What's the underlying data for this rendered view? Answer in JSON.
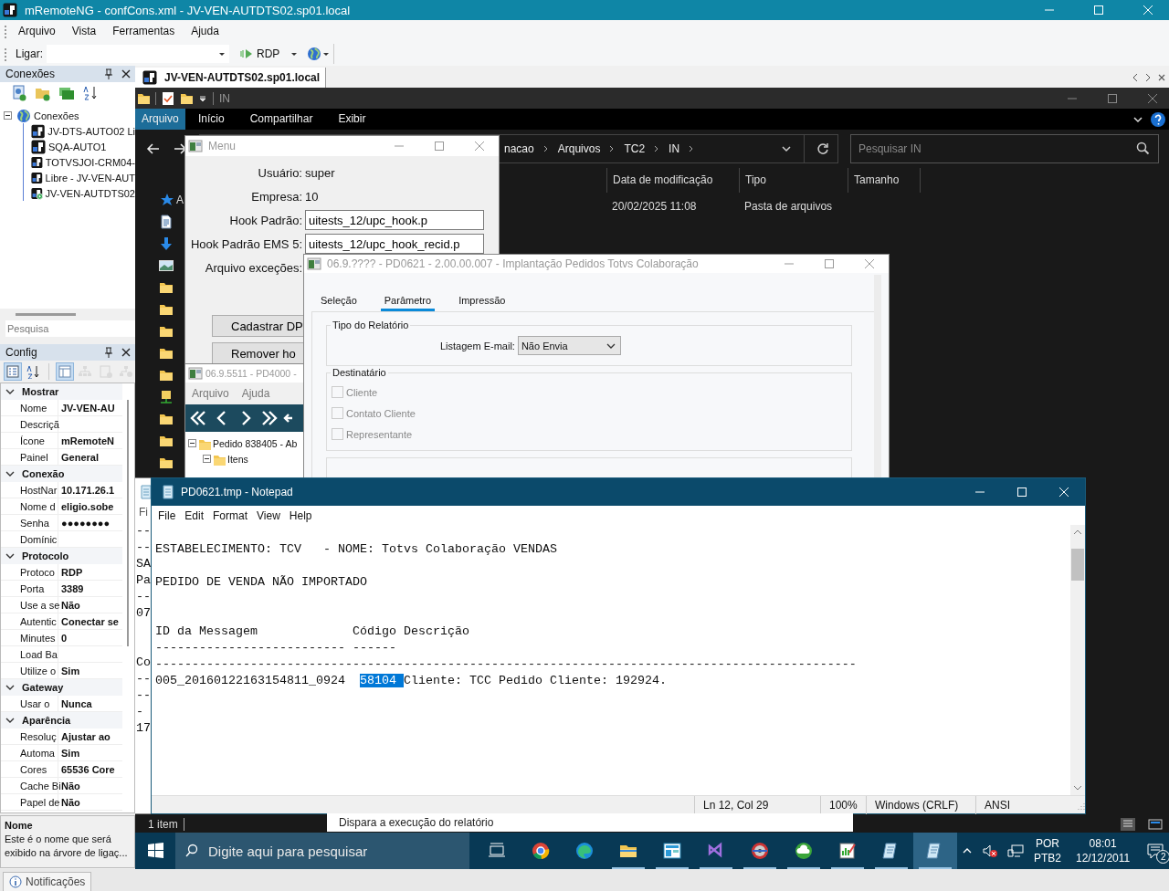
{
  "app": {
    "title": "mRemoteNG - confCons.xml - JV-VEN-AUTDTS02.sp01.local",
    "menu": [
      "Arquivo",
      "Vista",
      "Ferramentas",
      "Ajuda"
    ],
    "connect_label": "Ligar:",
    "protocol": "RDP"
  },
  "connections": {
    "title": "Conexões",
    "root": {
      "label": "Conexões",
      "expanded": true,
      "children": [
        {
          "label": "JV-DTS-AUTO02 Li",
          "connected": false
        },
        {
          "label": "SQA-AUTO1",
          "connected": false
        },
        {
          "label": "TOTVSJOI-CRM04-",
          "connected": false
        },
        {
          "label": "Libre - JV-VEN-AUT",
          "connected": false
        },
        {
          "label": "JV-VEN-AUTDTS02",
          "connected": true
        }
      ]
    },
    "search_placeholder": "Pesquisa"
  },
  "config": {
    "title": "Config",
    "view_buttons": [
      {
        "kind": "categorized",
        "selected": true,
        "disabled": false
      },
      {
        "kind": "alphabetical",
        "selected": false,
        "disabled": false
      },
      {
        "kind": "properties",
        "selected": true,
        "disabled": false
      },
      {
        "kind": "hierarchy",
        "selected": false,
        "disabled": true
      },
      {
        "kind": "page_add",
        "selected": false,
        "disabled": true
      },
      {
        "kind": "tree_add",
        "selected": false,
        "disabled": true
      }
    ],
    "groups": [
      {
        "name": "Mostrar",
        "expanded": true,
        "properties": [
          {
            "name": "Nome",
            "value": "JV-VEN-AU"
          },
          {
            "name": "Descriçã"
          },
          {
            "name": "Ícone",
            "value": "mRemoteN"
          },
          {
            "name": "Painel",
            "value": "General"
          }
        ]
      },
      {
        "name": "Conexão",
        "expanded": true,
        "properties": [
          {
            "name": "HostNar",
            "value": "10.171.26.1"
          },
          {
            "name": "Nome d",
            "value": "eligio.sobe"
          },
          {
            "name": "Senha",
            "value": "●●●●●●●●"
          },
          {
            "name": "Domínic"
          }
        ]
      },
      {
        "name": "Protocolo",
        "expanded": true,
        "properties": [
          {
            "name": "Protoco",
            "value": "RDP"
          },
          {
            "name": "Porta",
            "value": "3389"
          },
          {
            "name": "Use a se",
            "value": "Não"
          },
          {
            "name": "Autentic",
            "value": "Conectar se"
          },
          {
            "name": "Minutes",
            "value": "0"
          },
          {
            "name": "Load Ba"
          },
          {
            "name": "Utilize o",
            "value": "Sim"
          }
        ]
      },
      {
        "name": "Gateway",
        "expanded": true,
        "properties": [
          {
            "name": "Usar o",
            "value": "Nunca"
          }
        ]
      },
      {
        "name": "Aparência",
        "expanded": true,
        "properties": [
          {
            "name": "Resoluç",
            "value": "Ajustar ao"
          },
          {
            "name": "Automa",
            "value": "Sim"
          },
          {
            "name": "Cores",
            "value": "65536 Core"
          },
          {
            "name": "Cache Bi",
            "value": "Não"
          },
          {
            "name": "Papel de",
            "value": "Não"
          }
        ]
      }
    ],
    "help": {
      "title": "Nome",
      "text": "Este é o nome que será exibido na árvore de ligaç..."
    }
  },
  "document_tab": {
    "title": "JV-VEN-AUTDTS02.sp01.local",
    "selected": true
  },
  "explorer": {
    "quick_title": "IN",
    "ribbon_tabs": [
      {
        "label": "Arquivo",
        "selected": true
      },
      {
        "label": "Início",
        "selected": false
      },
      {
        "label": "Compartilhar",
        "selected": false
      },
      {
        "label": "Exibir",
        "selected": false
      }
    ],
    "breadcrumb": [
      "nacao",
      "Arquivos",
      "TC2",
      "IN"
    ],
    "search_placeholder": "Pesquisar IN",
    "nav_label": "A",
    "columns": [
      "Data de modificação",
      "Tipo",
      "Tamanho"
    ],
    "rows": [
      {
        "modified": "20/02/2025 11:08",
        "type": "Pasta de arquivos"
      }
    ],
    "status": "1 item"
  },
  "menu_window": {
    "title": "Menu",
    "info": [
      {
        "label": "Usuário:",
        "value": "super"
      },
      {
        "label": "Empresa:",
        "value": "10"
      }
    ],
    "fields": [
      {
        "label": "Hook Padrão:",
        "value": "uitests_12/upc_hook.p"
      },
      {
        "label": "Hook Padrão EMS 5:",
        "value": "uitests_12/upc_hook_recid.p"
      },
      {
        "label": "Arquivo exceções:"
      }
    ],
    "buttons": [
      "Cadastrar DP",
      "Remover ho"
    ]
  },
  "pd4000_window": {
    "title": "06.9.5511 - PD4000 -",
    "menu": [
      "Arquivo",
      "Ajuda"
    ],
    "tree": [
      {
        "label": "Pedido 838405 - Ab",
        "expanded": true,
        "children": [
          {
            "label": "Itens",
            "expanded": true
          }
        ]
      }
    ]
  },
  "pd0621_window": {
    "title": "06.9.???? - PD0621 - 2.00.00.007 - Implantação Pedidos Totvs Colaboração",
    "tabs": [
      {
        "label": "Seleção",
        "selected": false
      },
      {
        "label": "Parâmetro",
        "selected": true
      },
      {
        "label": "Impressão",
        "selected": false
      }
    ],
    "report_type": {
      "legend": "Tipo do Relatório",
      "label": "Listagem E-mail:",
      "value": "Não Envia"
    },
    "recipient": {
      "legend": "Destinatário",
      "options": [
        {
          "label": "Cliente",
          "checked": false,
          "disabled": true
        },
        {
          "label": "Contato Cliente",
          "checked": false,
          "disabled": true
        },
        {
          "label": "Representante",
          "checked": false,
          "disabled": true
        }
      ]
    }
  },
  "back_window": {
    "menu_fragment": "Fi",
    "line_groups": [
      [
        "--",
        "--",
        "SA",
        "Pa",
        "--",
        "07"
      ],
      [
        "Co",
        "--",
        "--",
        "-",
        "17"
      ]
    ]
  },
  "notepad": {
    "title": "PD0621.tmp - Notepad",
    "menu": [
      "File",
      "Edit",
      "Format",
      "View",
      "Help"
    ],
    "lines": [
      {
        "blank": true
      },
      {
        "blank": false,
        "segments": [
          {
            "text": "ESTABELECIMENTO: TCV   - NOME: Totvs Colaboração VENDAS",
            "selected": false
          }
        ]
      },
      {
        "blank": true
      },
      {
        "blank": false,
        "segments": [
          {
            "text": "PEDIDO DE VENDA NÃO IMPORTADO",
            "selected": false
          }
        ]
      },
      {
        "blank": true
      },
      {
        "blank": true
      },
      {
        "blank": false,
        "segments": [
          {
            "text": "ID da Messagem             Código Descrição",
            "selected": false
          }
        ]
      },
      {
        "blank": false,
        "segments": [
          {
            "text": "-------------------------- ------",
            "selected": false
          }
        ]
      },
      {
        "blank": false,
        "segments": [
          {
            "text": "------------------------------------------------------------------------------------------------",
            "selected": false
          }
        ]
      },
      {
        "blank": false,
        "segments": [
          {
            "text": "005_20160122163154811_0924  ",
            "selected": false
          },
          {
            "text": "58104 ",
            "selected": true
          },
          {
            "text": "Cliente: TCC Pedido Cliente: 192924.",
            "selected": false
          }
        ]
      }
    ],
    "status": [
      "Ln 12, Col 29",
      "100%",
      "Windows (CRLF)",
      "ANSI"
    ]
  },
  "footer_hint": "Dispara a execução do relatório",
  "taskbar": {
    "search_placeholder": "Digite aqui para pesquisar",
    "apps": [
      {
        "kind": "task_view",
        "running": false,
        "active": false
      },
      {
        "kind": "chrome",
        "running": false,
        "active": false
      },
      {
        "kind": "edge",
        "running": false,
        "active": false
      },
      {
        "kind": "folder",
        "running": true,
        "active": false
      },
      {
        "kind": "board",
        "running": true,
        "active": false
      },
      {
        "kind": "studio",
        "running": true,
        "active": false
      },
      {
        "kind": "disc",
        "running": true,
        "active": false
      },
      {
        "kind": "cloud",
        "running": true,
        "active": false
      },
      {
        "kind": "chart_pad",
        "running": true,
        "active": false
      },
      {
        "kind": "notepad",
        "running": true,
        "active": false
      },
      {
        "kind": "notepad",
        "running": true,
        "active": true
      }
    ],
    "language": [
      "POR",
      "PTB2"
    ],
    "time": "08:01",
    "date": "12/12/2011",
    "notifications": "2"
  },
  "notifications_tab": "Notificações"
}
